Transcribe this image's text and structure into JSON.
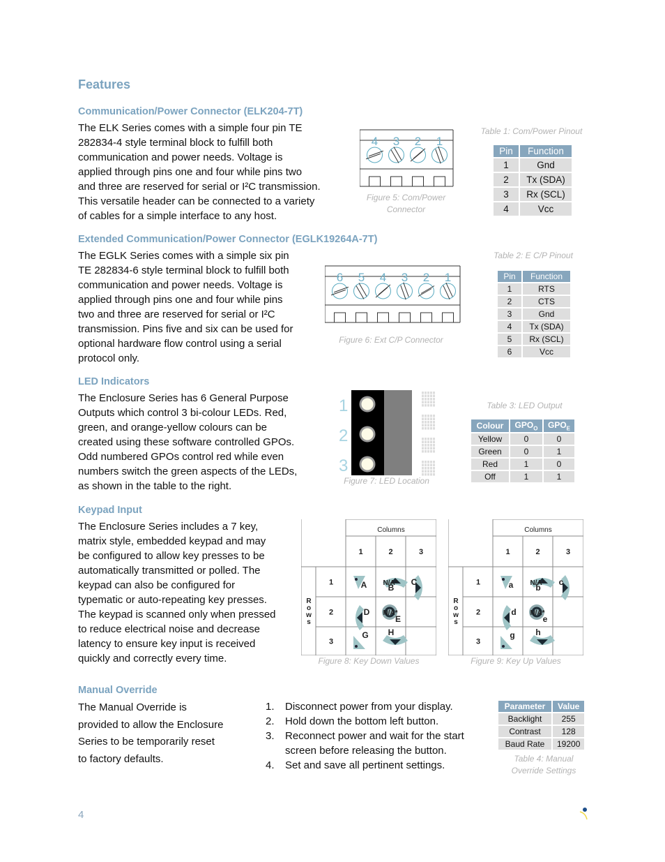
{
  "page": {
    "title": "Features",
    "page_number": "4"
  },
  "sections": {
    "comm": {
      "heading": "Communication/Power Connector (ELK204-7T)",
      "lines": [
        "The ELK Series comes with a simple four pin TE",
        "282834-4 style terminal block to fulfill both",
        "communication and power needs.  Voltage is",
        "applied through pins one and four while pins two",
        "and three are reserved for serial or I²C transmission.",
        "This versatile header can be connected to a variety",
        "of cables for a simple interface to any host."
      ],
      "figure_caption": "Figure 5: Com/Power Connector",
      "figure_pins": [
        "4",
        "3",
        "2",
        "1"
      ],
      "table_caption": "Table 1: Com/Power Pinout",
      "table": {
        "headers": [
          "Pin",
          "Function"
        ],
        "rows": [
          [
            "1",
            "Gnd"
          ],
          [
            "2",
            "Tx (SDA)"
          ],
          [
            "3",
            "Rx (SCL)"
          ],
          [
            "4",
            "Vcc"
          ]
        ]
      }
    },
    "ext": {
      "heading": "Extended Communication/Power Connector (EGLK19264A-7T)",
      "lines": [
        "The EGLK Series comes with a simple six pin",
        "TE 282834-6 style terminal block to fulfill both",
        "communication and power needs.  Voltage is",
        "applied through pins one and four while pins",
        "two and three are reserved for serial or I²C",
        "transmission.  Pins five and six can be used for",
        "optional hardware flow control using a serial",
        "protocol only."
      ],
      "figure_caption": "Figure 6: Ext C/P Connector",
      "figure_pins": [
        "6",
        "5",
        "4",
        "3",
        "2",
        "1"
      ],
      "table_caption": "Table 2: E C/P Pinout",
      "table": {
        "headers": [
          "Pin",
          "Function"
        ],
        "rows": [
          [
            "1",
            "RTS"
          ],
          [
            "2",
            "CTS"
          ],
          [
            "3",
            "Gnd"
          ],
          [
            "4",
            "Tx (SDA)"
          ],
          [
            "5",
            "Rx (SCL)"
          ],
          [
            "6",
            "Vcc"
          ]
        ]
      }
    },
    "led": {
      "heading": "LED Indicators",
      "lines": [
        "The Enclosure Series has 6 General Purpose",
        "Outputs which control 3 bi-colour LEDs. Red,",
        "green, and orange-yellow colours can be",
        "created using these software controlled GPOs.",
        "Odd numbered GPOs control red while even",
        "numbers switch the green aspects of the LEDs,",
        "as shown in the table to the right."
      ],
      "figure_caption": "Figure 7: LED Location",
      "figure_labels": [
        "1",
        "2",
        "3"
      ],
      "table_caption": "Table 3: LED Output",
      "table": {
        "headers": [
          "Colour",
          "GPO",
          "GPO"
        ],
        "header_subs": [
          "",
          "O",
          "E"
        ],
        "rows": [
          [
            "Yellow",
            "0",
            "0"
          ],
          [
            "Green",
            "0",
            "1"
          ],
          [
            "Red",
            "1",
            "0"
          ],
          [
            "Off",
            "1",
            "1"
          ]
        ]
      }
    },
    "keypad": {
      "heading": "Keypad Input",
      "lines": [
        "The Enclosure Series includes a 7 key,",
        "matrix style, embedded keypad and may",
        "be configured to allow key presses to be",
        "automatically transmitted or polled. The",
        "keypad can also be configured for",
        "typematic or auto-repeating key presses.",
        "The keypad is scanned only when pressed",
        "to reduce electrical noise and decrease",
        "latency to ensure key input is received",
        "quickly and correctly every time."
      ],
      "grid_labels": {
        "columns": "Columns",
        "rows": "Rows",
        "col_numbers": [
          "1",
          "2",
          "3"
        ],
        "row_numbers": [
          "1",
          "2",
          "3"
        ],
        "na": "N/A*"
      },
      "down": {
        "caption": "Figure 8: Key Down Values",
        "keys": [
          "A",
          "B",
          "C",
          "D",
          "E",
          "G",
          "H"
        ]
      },
      "up": {
        "caption": "Figure 9: Key Up Values",
        "keys": [
          "a",
          "b",
          "c",
          "d",
          "e",
          "g",
          "h"
        ]
      }
    },
    "override": {
      "heading": "Manual Override",
      "lines": [
        "The Manual Override is",
        "provided to allow the Enclosure",
        "Series to be temporarily reset",
        "to factory defaults."
      ],
      "steps": [
        {
          "n": "1.",
          "lines": [
            "Disconnect power from your display."
          ]
        },
        {
          "n": "2.",
          "lines": [
            "Hold down the bottom left button."
          ]
        },
        {
          "n": "3.",
          "lines": [
            "Reconnect power and wait for the start",
            "screen before releasing the button."
          ]
        },
        {
          "n": "4.",
          "lines": [
            "Set and save all pertinent settings."
          ]
        }
      ],
      "table_caption": "Table 4: Manual Override Settings",
      "table": {
        "headers": [
          "Parameter",
          "Value"
        ],
        "rows": [
          [
            "Backlight",
            "255"
          ],
          [
            "Contrast",
            "128"
          ],
          [
            "Baud Rate",
            "19200"
          ]
        ]
      }
    }
  },
  "colors": {
    "heading": "#7ba3bf",
    "table_header": "#87a6bd",
    "table_cell": "#dedede",
    "caption": "#b3b3b3",
    "key_fill": "#9fc4c6"
  }
}
